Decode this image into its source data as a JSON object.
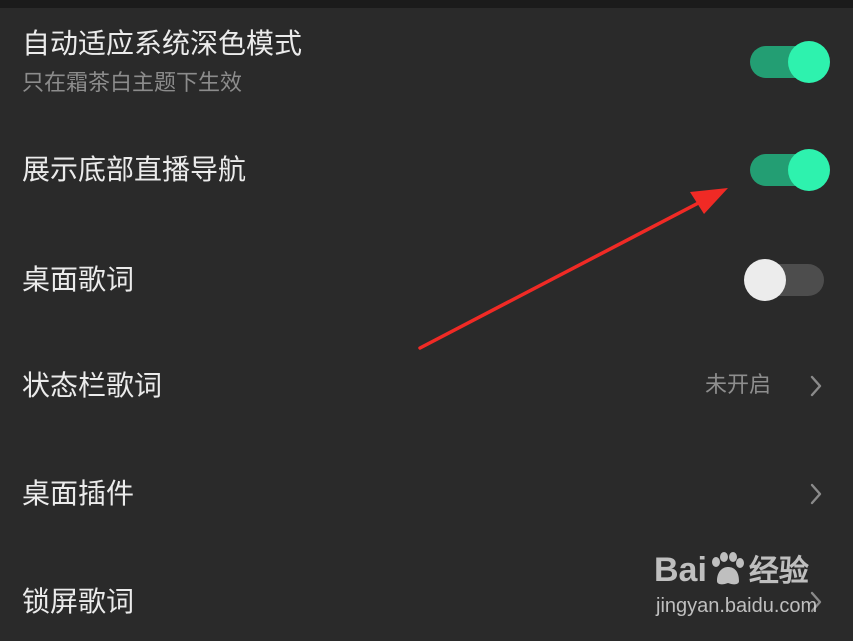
{
  "settings": [
    {
      "title": "自动适应系统深色模式",
      "subtitle": "只在霜茶白主题下生效",
      "control": "switch",
      "state": "on"
    },
    {
      "title": "展示底部直播导航",
      "control": "switch",
      "state": "on"
    },
    {
      "title": "桌面歌词",
      "control": "switch",
      "state": "off"
    },
    {
      "title": "状态栏歌词",
      "value": "未开启",
      "control": "chevron-right-icon"
    },
    {
      "title": "桌面插件",
      "control": "chevron-right-icon"
    },
    {
      "title": "锁屏歌词",
      "control": "chevron-right-icon"
    }
  ],
  "watermark": {
    "logo_left": "Bai",
    "logo_right": "经验",
    "url": "jingyan.baidu.com"
  },
  "colors": {
    "background": "#2a2a2a",
    "switch_on_track": "#239e73",
    "switch_on_knob": "#2ef2ae",
    "switch_off_track": "#4d4d4d",
    "switch_off_knob": "#ececec",
    "annotation_arrow": "#f02a25"
  }
}
